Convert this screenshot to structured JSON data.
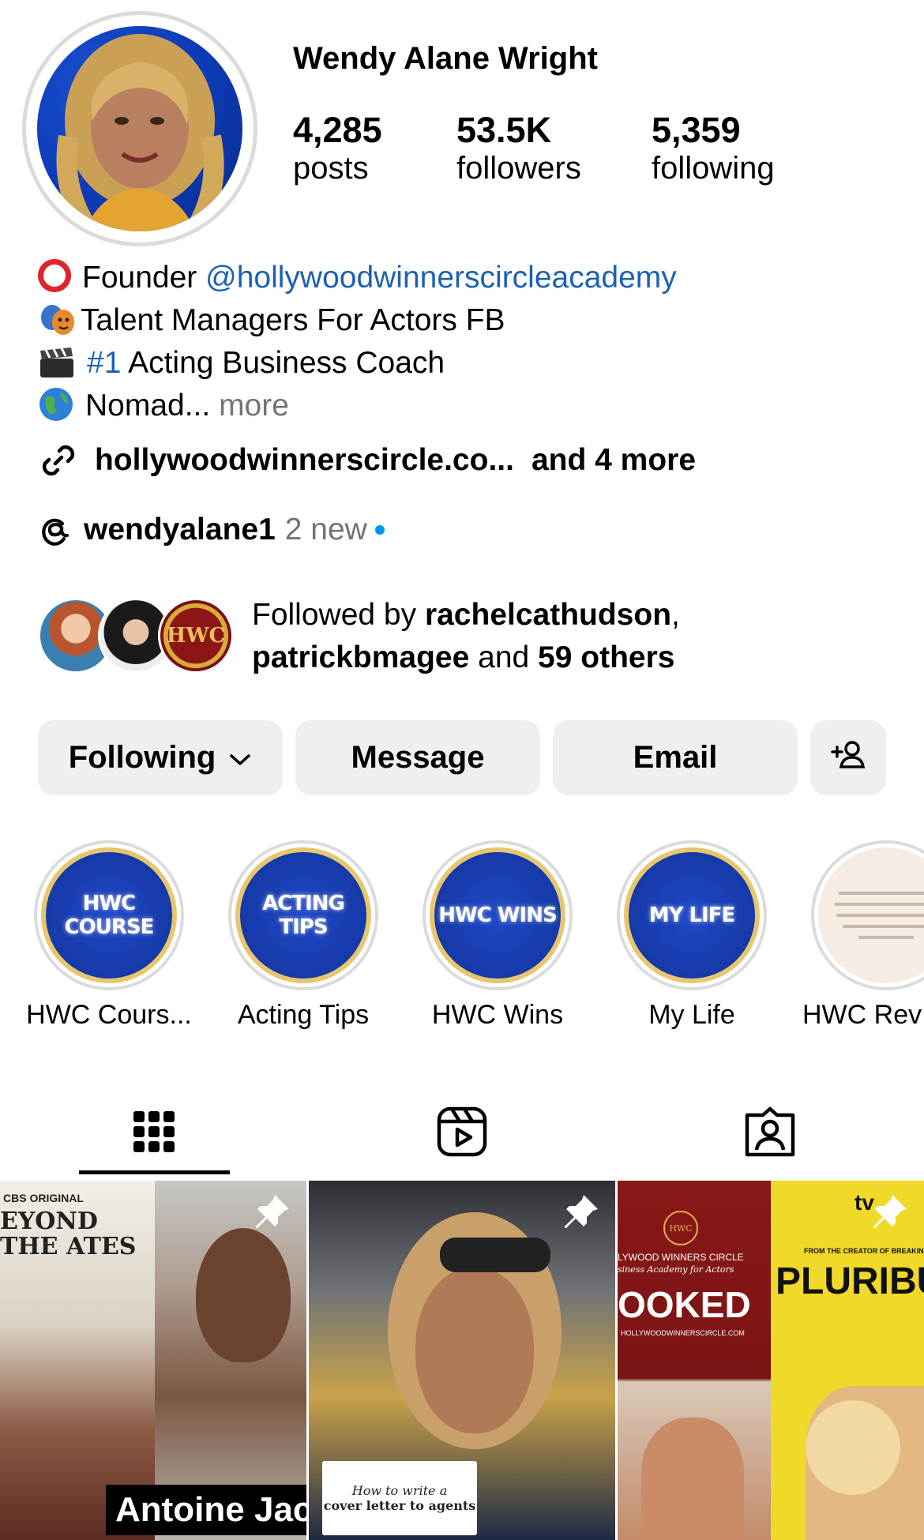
{
  "profile": {
    "name": "Wendy Alane Wright",
    "stats": [
      {
        "value": "4,285",
        "label": "posts"
      },
      {
        "value": "53.5K",
        "label": "followers"
      },
      {
        "value": "5,359",
        "label": "following"
      }
    ],
    "bio": {
      "line1_prefix": "Founder ",
      "line1_mention": "@hollywoodwinnerscircleacademy",
      "line2": "Talent Managers For Actors FB",
      "line3_tag": "#1",
      "line3_text": " Acting Business Coach",
      "line4_text": "Nomad...",
      "line4_more": " more"
    },
    "link": {
      "url": "hollywoodwinnerscircle.co...",
      "more": "and 4 more"
    },
    "threads": {
      "handle": "wendyalane1",
      "new_text": "2 new"
    },
    "followed_by": {
      "prefix": "Followed by ",
      "user1": "rachelcathudson",
      "comma": ",",
      "user2": "patrickbmagee",
      "and_text": " and ",
      "others": "59 others"
    }
  },
  "actions": {
    "following": "Following",
    "message": "Message",
    "email": "Email"
  },
  "highlights": [
    {
      "cover": "HWC COURSE",
      "label": "HWC Cours..."
    },
    {
      "cover": "ACTING TIPS",
      "label": "Acting Tips"
    },
    {
      "cover": "HWC WINS",
      "label": "HWC Wins"
    },
    {
      "cover": "MY LIFE",
      "label": "My Life"
    },
    {
      "cover": "",
      "label": "HWC Rev"
    }
  ],
  "posts": [
    {
      "overlay_top": "CBS ORIGINAL",
      "title": "EYOND THE ATES",
      "caption": "Antoine Jac"
    },
    {
      "caption_line1": "How to write a",
      "caption_line2": "cover letter to agents"
    },
    {
      "brand": "LYWOOD WINNERS CIRCLE",
      "sub": "siness Academy for Actors",
      "title": "OOKED",
      "url": "HOLLYWOODWINNERSCIRCLE.COM",
      "tv": "tv",
      "creator": "FROM THE CREATOR OF BREAKING",
      "show": "PLURIBU"
    }
  ],
  "colors": {
    "link_blue": "#1b61b4",
    "button_bg": "#efefef",
    "muted": "#737373",
    "threads_dot": "#0095f6"
  },
  "icons": [
    "link-icon",
    "threads-icon",
    "chevron-down-icon",
    "add-person-icon",
    "grid-icon",
    "reels-icon",
    "tagged-icon",
    "pin-icon"
  ]
}
